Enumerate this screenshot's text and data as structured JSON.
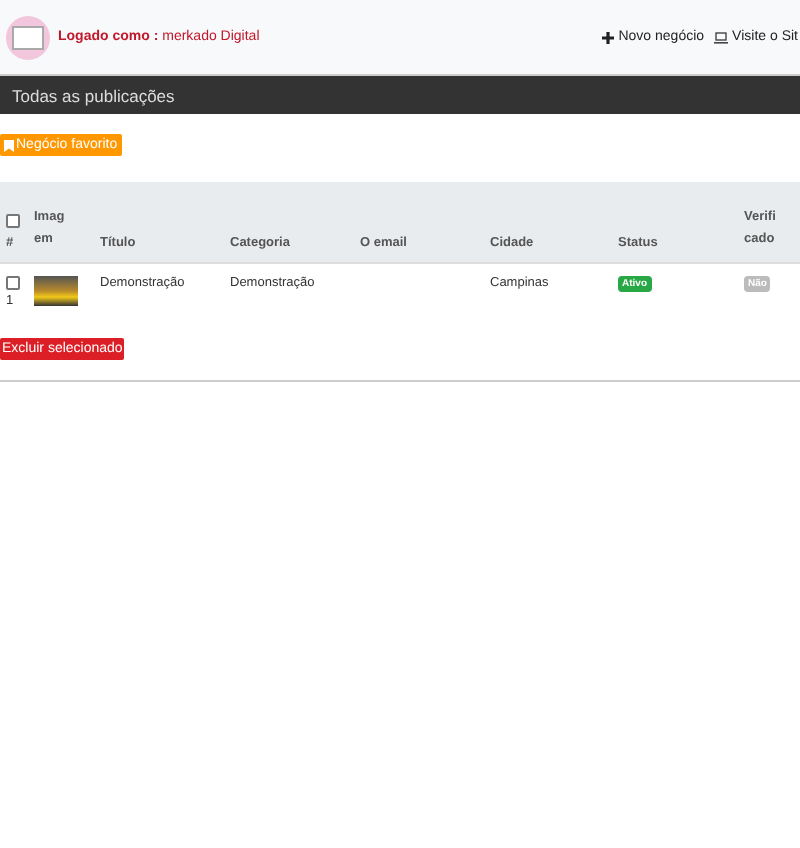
{
  "header": {
    "logged_label": "Logado como :",
    "user": "merkado Digital",
    "links": [
      {
        "kind": "add",
        "label": "Novo negócio"
      },
      {
        "kind": "site",
        "label": "Visite o Sit"
      }
    ]
  },
  "title_bar": {
    "title": "Todas as publicações"
  },
  "favorite_button": {
    "label": "Negócio favorito"
  },
  "table": {
    "columns": [
      "#",
      "Imagem",
      "Título",
      "Categoria",
      "O email",
      "Cidade",
      "Status",
      "Verificado"
    ],
    "select_all_checked": false,
    "rows": [
      {
        "checked": false,
        "number": "1",
        "title": "Demonstração",
        "category": "Demonstração",
        "city": "Campinas",
        "status": {
          "label": "Ativo",
          "kind": "active"
        },
        "verified": {
          "label": "Não",
          "kind": "no"
        }
      }
    ]
  },
  "delete_button": {
    "label": "Excluir selecionado"
  }
}
